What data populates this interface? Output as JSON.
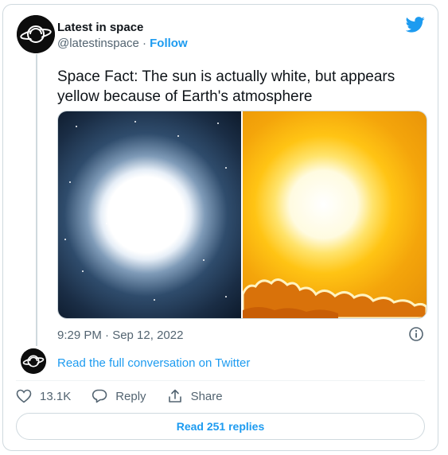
{
  "account": {
    "name": "Latest in space",
    "handle": "@latestinspace",
    "separator": "·",
    "follow_label": "Follow"
  },
  "tweet": {
    "text": "Space Fact: The sun is actually white, but appears yellow because of Earth's atmosphere",
    "timestamp": "9:29 PM · Sep 12, 2022"
  },
  "media": {
    "left_image": "sun-in-space",
    "right_image": "sun-through-atmosphere"
  },
  "conversation_link": "Read the full conversation on Twitter",
  "actions": {
    "like_count": "13.1K",
    "reply_label": "Reply",
    "share_label": "Share"
  },
  "read_replies_label": "Read 251 replies",
  "colors": {
    "accent": "#1d9bf0",
    "secondary_text": "#536471",
    "border": "#cfd9de"
  },
  "icons": [
    "twitter-bird-icon",
    "info-icon",
    "heart-icon",
    "reply-icon",
    "share-icon"
  ]
}
